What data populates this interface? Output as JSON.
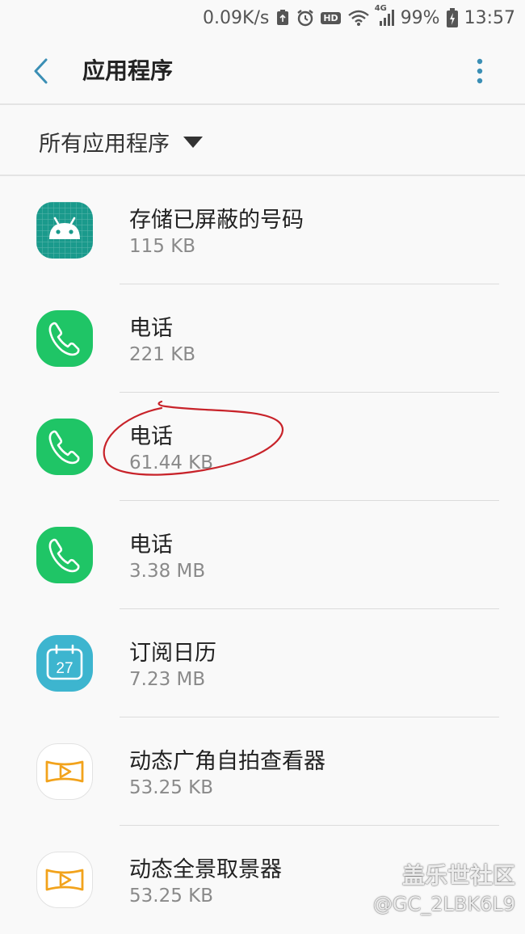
{
  "status_bar": {
    "net_speed": "0.09K/s",
    "hd_badge": "HD",
    "net_type": "4G",
    "battery": "99%",
    "time": "13:57"
  },
  "toolbar": {
    "title": "应用程序"
  },
  "filter": {
    "label": "所有应用程序"
  },
  "apps": [
    {
      "name": "存储已屏蔽的号码",
      "size": "115 KB",
      "icon": "android-icon",
      "color": "#1a9a8c"
    },
    {
      "name": "电话",
      "size": "221 KB",
      "icon": "phone-icon",
      "color": "#1fc566"
    },
    {
      "name": "电话",
      "size": "61.44 KB",
      "icon": "phone-icon",
      "color": "#1fc566"
    },
    {
      "name": "电话",
      "size": "3.38 MB",
      "icon": "phone-icon",
      "color": "#1fc566"
    },
    {
      "name": "订阅日历",
      "size": "7.23 MB",
      "icon": "calendar-icon",
      "color": "#3db5cf",
      "icon_text": "27"
    },
    {
      "name": "动态广角自拍查看器",
      "size": "53.25 KB",
      "icon": "panorama-play-icon",
      "color": "#f2a31c"
    },
    {
      "name": "动态全景取景器",
      "size": "53.25 KB",
      "icon": "panorama-play-icon",
      "color": "#f2a31c"
    }
  ],
  "watermark": {
    "title": "盖乐世社区",
    "user": "@GC_2LBK6L9"
  },
  "colors": {
    "accent": "#3b8fb5",
    "annotation": "#c8232a"
  }
}
